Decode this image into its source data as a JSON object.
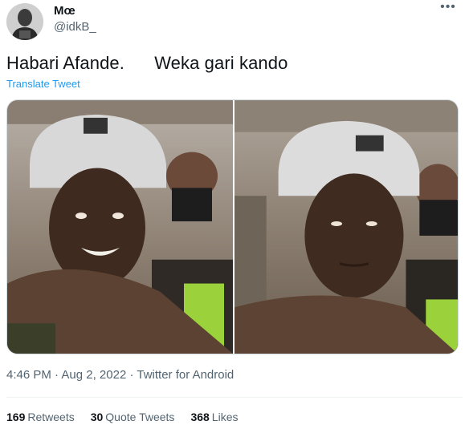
{
  "author": {
    "display_name": "Mœ",
    "handle": "@idkB_"
  },
  "more_icon": "more-horizontal-icon",
  "tweet": {
    "text": "Habari Afande.      Weka gari kando",
    "translate_label": "Translate Tweet"
  },
  "meta": {
    "time": "4:46 PM",
    "date": "Aug 2, 2022",
    "source": "Twitter for Android",
    "separator": "·"
  },
  "stats": {
    "retweets_count": "169",
    "retweets_label": "Retweets",
    "quotes_count": "30",
    "quotes_label": "Quote Tweets",
    "likes_count": "368",
    "likes_label": "Likes"
  },
  "colors": {
    "link": "#1d9bf0",
    "secondary_text": "#536471",
    "primary_text": "#0f1419"
  }
}
